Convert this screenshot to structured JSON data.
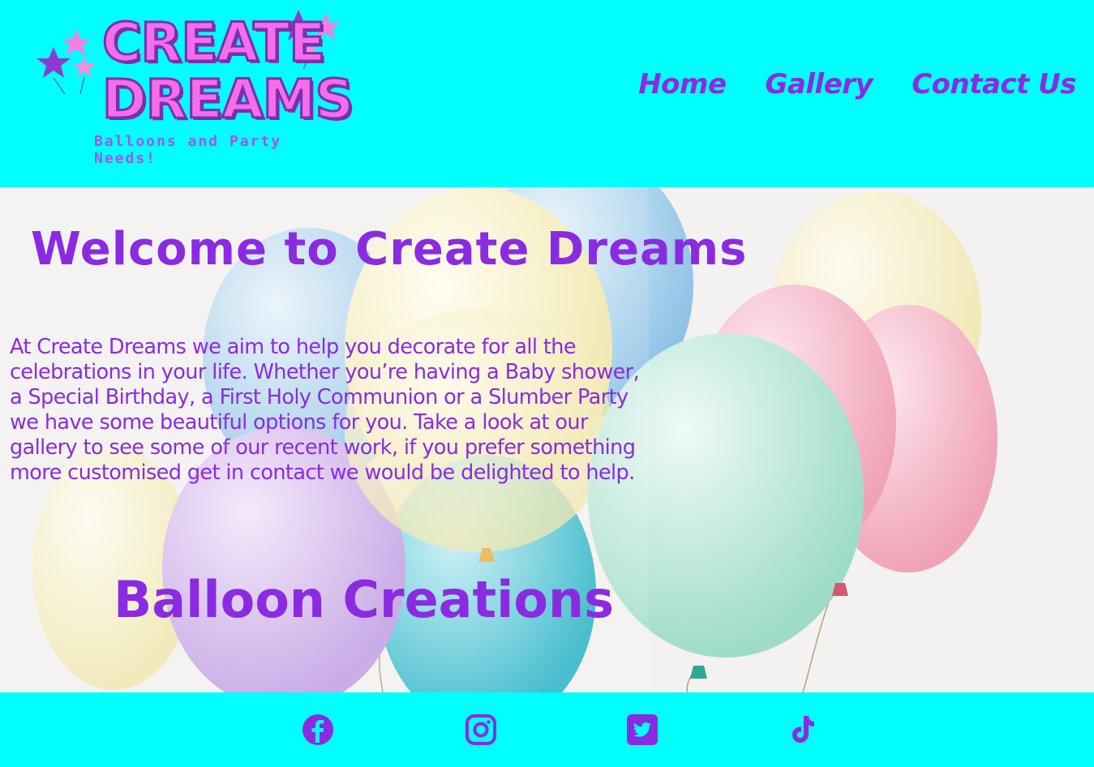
{
  "header": {
    "logo": {
      "line1": "CREATE",
      "line2": "DREAMS",
      "tagline": "Balloons and Party Needs!"
    },
    "nav": [
      {
        "label": "Home"
      },
      {
        "label": "Gallery"
      },
      {
        "label": "Contact Us"
      }
    ]
  },
  "hero": {
    "title": "Welcome to Create Dreams",
    "intro": "At Create Dreams we aim to help you decorate for all the celebrations in your life. Whether you’re having a Baby shower, a Special Birthday, a First Holy Communion or a Slumber Party we have some beautiful options for you. Take a look at our gallery to see some of our recent work, if you prefer something more customised get in contact we would be delighted to help.",
    "subtitle": "Balloon Creations"
  },
  "footer": {
    "social": [
      {
        "icon": "facebook-icon"
      },
      {
        "icon": "instagram-icon"
      },
      {
        "icon": "twitter-icon"
      },
      {
        "icon": "tiktok-icon"
      }
    ]
  },
  "colors": {
    "background": "#00ffff",
    "accent": "#8a2be2",
    "logo_pink": "#f56ee8"
  }
}
